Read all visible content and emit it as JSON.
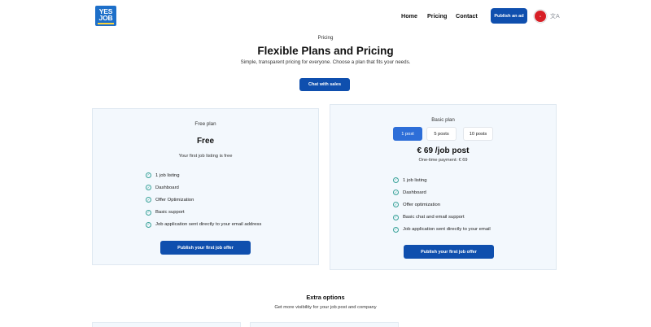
{
  "header": {
    "logo_line1": "YES",
    "logo_line2": "JOB",
    "nav": [
      "Home",
      "Pricing",
      "Contact"
    ],
    "publish_button": "Publish an ad",
    "lang_icon": "文A"
  },
  "hero": {
    "eyebrow": "Pricing",
    "title": "Flexible Plans and Pricing",
    "subtitle": "Simple, transparent pricing for everyone. Choose a plan that fits your needs.",
    "chat_button": "Chat with sales"
  },
  "free_plan": {
    "label": "Free plan",
    "price": "Free",
    "description": "Your first job listing is free",
    "features": [
      "1 job listing",
      "Dashboard",
      "Offer Optimization",
      "Basic support",
      "Job application sent directly to your email address"
    ],
    "button": "Publish your first job offer"
  },
  "basic_plan": {
    "label": "Basic plan",
    "options": [
      "1 post",
      "5 posts",
      "10 posts"
    ],
    "selected_option": "1 post",
    "price": "€ 69 /job post",
    "payment_note": "One-time payment: € 69",
    "features": [
      "1 job listing",
      "Dashboard",
      "Offer optimization",
      "Basic chat and email support",
      "Job application sent directly to your email"
    ],
    "button": "Publish your first job offer"
  },
  "extra": {
    "title": "Extra options",
    "subtitle": "Get more visibility for your job post and company"
  },
  "colors": {
    "primary": "#0f4fae",
    "accent": "#2d6ed8",
    "card_bg": "#f3f8fd",
    "check": "#3aa39a",
    "logo_bg": "#1d6fc9"
  }
}
